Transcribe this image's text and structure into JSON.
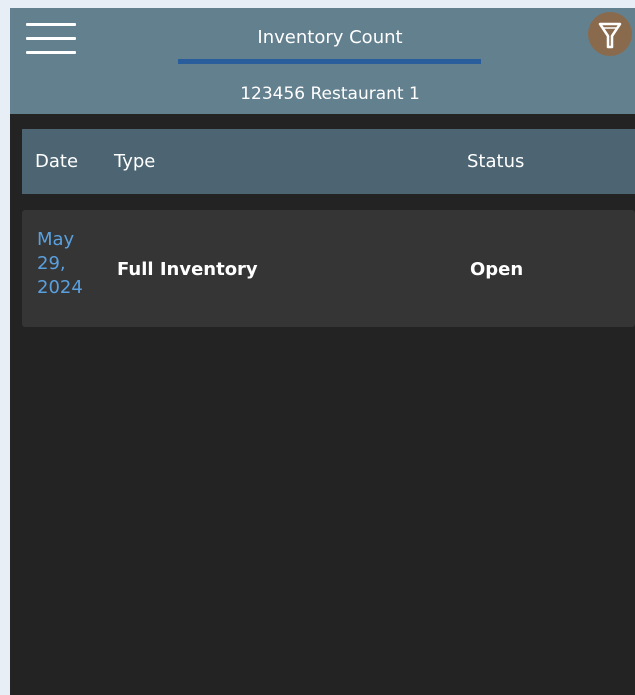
{
  "header": {
    "title": "Inventory Count",
    "subtitle": "123456 Restaurant 1",
    "menu_icon": "hamburger-menu-icon",
    "filter_icon": "filter-funnel-icon"
  },
  "table": {
    "columns": {
      "date": "Date",
      "type": "Type",
      "status": "Status"
    },
    "rows": [
      {
        "date_line1": "May",
        "date_line2": "29,",
        "date_line3": "2024",
        "type": "Full Inventory",
        "status": "Open"
      }
    ]
  },
  "colors": {
    "header_bg": "#63808f",
    "tab_underline": "#2a5d9b",
    "table_header_bg": "#4d6573",
    "row_bg": "#353535",
    "page_bg": "#232323",
    "date_link": "#5aa0df",
    "filter_button": "#8a6a4d"
  }
}
